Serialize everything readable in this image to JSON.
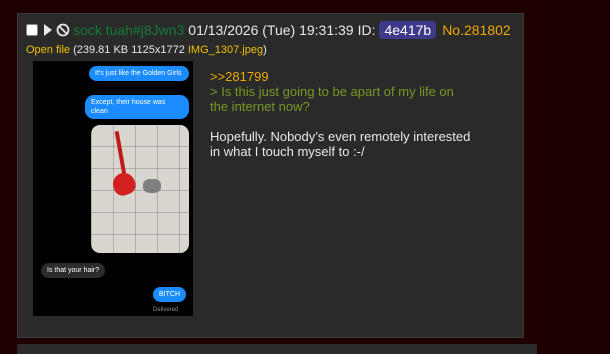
{
  "post": {
    "name": "sock tuah#j8Jwn3",
    "datetime": "01/13/2026 (Tue) 19:31:39",
    "id_label": "ID:",
    "id_value": "4e417b",
    "post_number": "No.281802",
    "file": {
      "open_label": "Open file",
      "meta": "(239.81 KB 1125x1772",
      "filename": "IMG_1307.jpeg",
      "close_paren": ")"
    },
    "quote_link": ">>281799",
    "greentext_line1": "> Is this just going to be apart of my life on",
    "greentext_line2": "the internet now?",
    "body_line1": "Hopefully. Nobody’s even remotely interested",
    "body_line2": "in what I touch myself to :-/"
  },
  "thumbnail": {
    "msg1": "It's just like the Golden Girls",
    "msg2": "Except, their house was clean",
    "msg3": "Is that your hair?",
    "msg4": "BITCH",
    "delivered": "Delivered"
  },
  "colors": {
    "background": "#1f0000",
    "post_bg": "#2a2a2a",
    "name": "#157a36",
    "postno": "#f0a800",
    "greentext": "#789922",
    "id_badge": "#3e3a8a",
    "imessage_blue": "#1a8cff"
  },
  "icons": [
    "checkbox-icon",
    "play-icon",
    "ban-icon"
  ]
}
